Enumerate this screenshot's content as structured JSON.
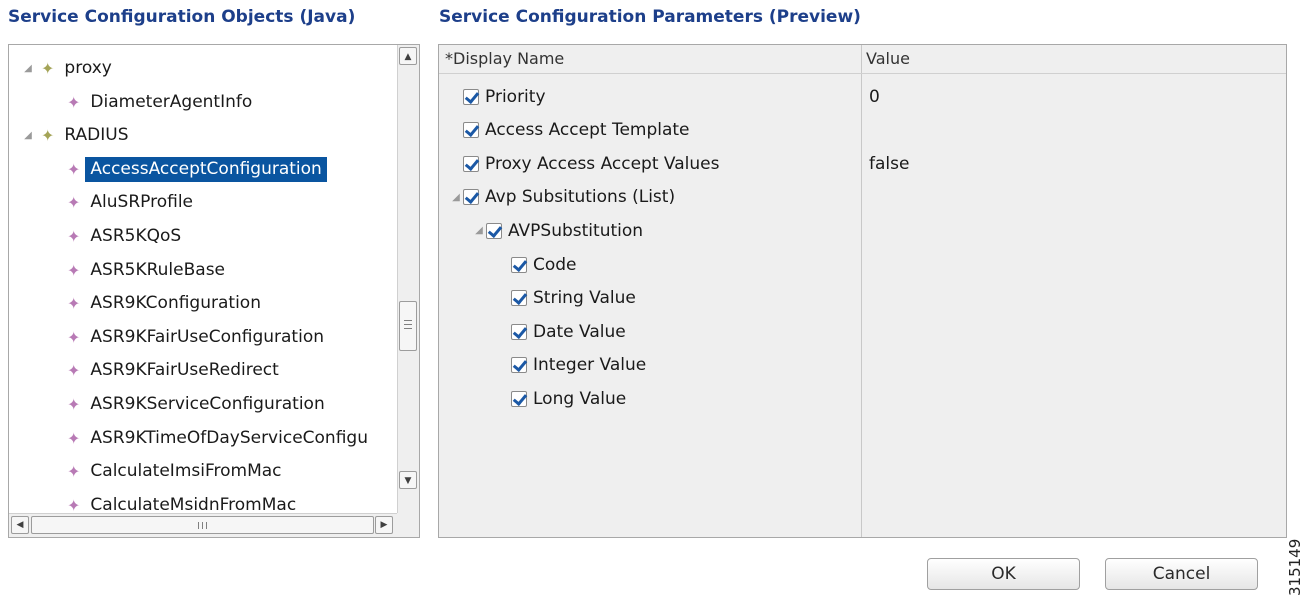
{
  "left_panel": {
    "title": "Service Configuration Objects (Java)",
    "tree": [
      {
        "label": "proxy",
        "expanded": true,
        "level": 0,
        "folder": true
      },
      {
        "label": "DiameterAgentInfo",
        "level": 1
      },
      {
        "label": "RADIUS",
        "expanded": true,
        "level": 0,
        "folder": true
      },
      {
        "label": "AccessAcceptConfiguration",
        "level": 1,
        "selected": true
      },
      {
        "label": "AluSRProfile",
        "level": 1
      },
      {
        "label": "ASR5KQoS",
        "level": 1
      },
      {
        "label": "ASR5KRuleBase",
        "level": 1
      },
      {
        "label": "ASR9KConfiguration",
        "level": 1
      },
      {
        "label": "ASR9KFairUseConfiguration",
        "level": 1
      },
      {
        "label": "ASR9KFairUseRedirect",
        "level": 1
      },
      {
        "label": "ASR9KServiceConfiguration",
        "level": 1
      },
      {
        "label": "ASR9KTimeOfDayServiceConfigu",
        "level": 1
      },
      {
        "label": "CalculateImsiFromMac",
        "level": 1
      },
      {
        "label": "CalculateMsidnFromMac",
        "level": 1
      }
    ],
    "scrollbar": {
      "vertical_position": 0.55,
      "grip": "≡",
      "horizontal_grip": "III"
    }
  },
  "right_panel": {
    "title": "Service Configuration Parameters (Preview)",
    "columns": {
      "name": "*Display Name",
      "value": "Value"
    },
    "rows": [
      {
        "label": "Priority",
        "value": "0",
        "level": 0,
        "checked": true
      },
      {
        "label": "Access Accept Template",
        "value": "",
        "level": 0,
        "checked": true
      },
      {
        "label": "Proxy Access Accept Values",
        "value": "false",
        "level": 0,
        "checked": true
      },
      {
        "label": "Avp Subsitutions (List)",
        "value": "",
        "level": 0,
        "checked": true,
        "expanded": true
      },
      {
        "label": "AVPSubstitution",
        "value": "",
        "level": 1,
        "checked": true,
        "expanded": true
      },
      {
        "label": "Code",
        "value": "",
        "level": 2,
        "checked": true
      },
      {
        "label": "String Value",
        "value": "",
        "level": 2,
        "checked": true
      },
      {
        "label": "Date Value",
        "value": "",
        "level": 2,
        "checked": true
      },
      {
        "label": "Integer Value",
        "value": "",
        "level": 2,
        "checked": true
      },
      {
        "label": "Long Value",
        "value": "",
        "level": 2,
        "checked": true
      }
    ]
  },
  "buttons": {
    "ok": "OK",
    "cancel": "Cancel"
  },
  "figure_id": "315149",
  "icons": {
    "expanded_triangle": "◢",
    "folder_node": "folder-diamond-icon",
    "leaf_node": "leaf-diamond-icon",
    "scroll_up": "▲",
    "scroll_down": "▼",
    "scroll_left": "◀",
    "scroll_right": "▶"
  },
  "colors": {
    "title": "#1d3f8a",
    "selection": "#0a55a0",
    "leaf_diamond": "#b87ab5",
    "folder_diamond": "#a4a457",
    "checkmark": "#1b58a5"
  }
}
